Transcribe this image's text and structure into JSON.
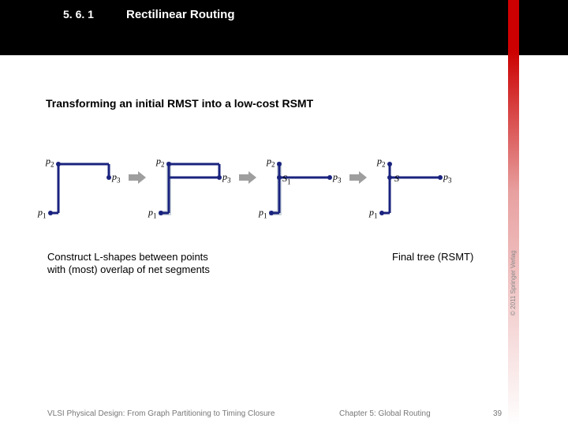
{
  "header": {
    "section_number": "5. 6. 1",
    "title": "Rectilinear Routing"
  },
  "subtitle": "Transforming an initial RMST into a low-cost RSMT",
  "labels": {
    "p1": "p",
    "p1_sub": "1",
    "p2": "p",
    "p2_sub": "2",
    "p3": "p",
    "p3_sub": "3",
    "S1": "S",
    "S1_sub": "1",
    "S": "S"
  },
  "caption_left_line1": "Construct L-shapes between points",
  "caption_left_line2": "with (most) overlap of net segments",
  "caption_right": "Final tree (RSMT)",
  "copyright": "© 2011 Springer Verlag",
  "footer": {
    "left": "VLSI Physical Design: From Graph Partitioning to Timing Closure",
    "center": "Chapter 5: Global Routing",
    "page": "39"
  },
  "colors": {
    "tree": "#1a237e",
    "highlight": "#cfd8dc",
    "arrow": "#9e9e9e"
  }
}
